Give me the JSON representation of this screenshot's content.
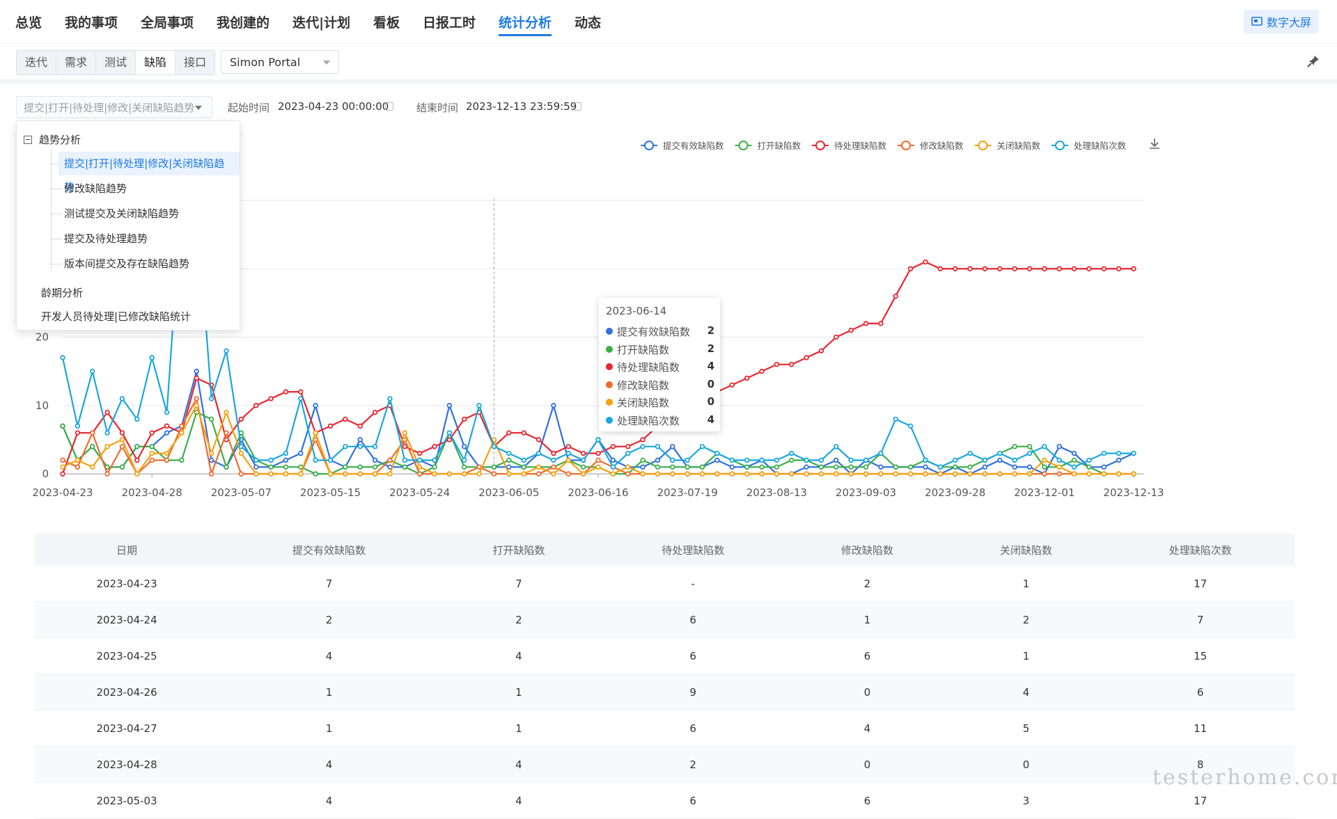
{
  "nav": {
    "items": [
      "总览",
      "我的事项",
      "全局事项",
      "我创建的",
      "迭代|计划",
      "看板",
      "日报工时",
      "统计分析",
      "动态"
    ],
    "active_index": 7,
    "screen_button": "数字大屏"
  },
  "subnav": {
    "segments": [
      "迭代",
      "需求",
      "测试",
      "缺陷",
      "接口"
    ],
    "active_index": 3,
    "project": "Simon Portal"
  },
  "filter": {
    "report": "提交|打开|待处理|修改|关闭缺陷趋势",
    "start_label": "起始时间",
    "start_value": "2023-04-23 00:00:00",
    "end_label": "结束时间",
    "end_value": "2023-12-13 23:59:59"
  },
  "dropdown": {
    "group1": "趋势分析",
    "items": [
      "提交|打开|待处理|修改|关闭缺陷趋势",
      "修改缺陷趋势",
      "测试提交及关闭缺陷趋势",
      "提交及待处理趋势",
      "版本间提交及存在缺陷趋势"
    ],
    "selected_index": 0,
    "group2": "龄期分析",
    "group3": "开发人员待处理|已修改缺陷统计"
  },
  "tooltip": {
    "date": "2023-06-14",
    "rows": [
      {
        "name": "提交有效缺陷数",
        "value": "2",
        "color": "#2f6fe0"
      },
      {
        "name": "打开缺陷数",
        "value": "2",
        "color": "#3cae49"
      },
      {
        "name": "待处理缺陷数",
        "value": "4",
        "color": "#e8262e"
      },
      {
        "name": "修改缺陷数",
        "value": "0",
        "color": "#f06a2e"
      },
      {
        "name": "关闭缺陷数",
        "value": "0",
        "color": "#f5a00f"
      },
      {
        "name": "处理缺陷次数",
        "value": "4",
        "color": "#1aa6de"
      }
    ]
  },
  "chart_data": {
    "type": "line",
    "legend_position": "top-right",
    "ylim": [
      0,
      40
    ],
    "yticks": [
      "0",
      "10",
      "20"
    ],
    "xtick_labels": [
      "2023-04-23",
      "2023-04-28",
      "2023-05-07",
      "2023-05-15",
      "2023-05-24",
      "2023-06-05",
      "2023-06-16",
      "2023-07-19",
      "2023-08-13",
      "2023-09-03",
      "2023-09-28",
      "2023-12-01",
      "2023-12-13"
    ],
    "series": [
      {
        "name": "提交有效缺陷数",
        "color": "#2f6fe0",
        "values": [
          7,
          2,
          4,
          1,
          1,
          4,
          4,
          6,
          7,
          15,
          2,
          1,
          5,
          1,
          1,
          2,
          3,
          10,
          2,
          1,
          5,
          2,
          1,
          1,
          2,
          1,
          10,
          4,
          1,
          1,
          1,
          1,
          3,
          10,
          2,
          2,
          5,
          2,
          1,
          1,
          2,
          4,
          1,
          1,
          2,
          1,
          1,
          2,
          0,
          0,
          1,
          1,
          2,
          0,
          2,
          1,
          1,
          1,
          1,
          0,
          1,
          0,
          1,
          2,
          1,
          1,
          0,
          4,
          3,
          1,
          1,
          2,
          3
        ]
      },
      {
        "name": "打开缺陷数",
        "color": "#3cae49",
        "values": [
          7,
          2,
          4,
          1,
          1,
          4,
          4,
          2,
          2,
          9,
          8,
          1,
          6,
          2,
          1,
          1,
          1,
          0,
          0,
          1,
          1,
          1,
          2,
          1,
          0,
          1,
          6,
          1,
          1,
          1,
          2,
          1,
          1,
          1,
          2,
          1,
          1,
          0,
          0,
          2,
          1,
          1,
          1,
          1,
          3,
          2,
          1,
          1,
          1,
          2,
          2,
          1,
          1,
          1,
          1,
          3,
          1,
          1,
          2,
          1,
          1,
          1,
          2,
          3,
          4,
          4,
          1,
          1,
          2,
          1,
          0,
          0,
          0
        ]
      },
      {
        "name": "待处理缺陷数",
        "color": "#e8262e",
        "values": [
          0,
          6,
          6,
          9,
          6,
          2,
          6,
          7,
          6,
          14,
          13,
          5,
          8,
          10,
          11,
          12,
          12,
          6,
          7,
          8,
          7,
          9,
          10,
          4,
          3,
          4,
          5,
          8,
          9,
          4,
          6,
          6,
          5,
          3,
          4,
          3,
          3,
          4,
          4,
          5,
          7,
          8,
          9,
          11,
          12,
          13,
          14,
          15,
          16,
          16,
          17,
          18,
          20,
          21,
          22,
          22,
          26,
          30,
          31,
          30,
          30,
          30,
          30,
          30,
          30,
          30,
          30,
          30,
          30,
          30,
          30,
          30,
          30
        ]
      },
      {
        "name": "修改缺陷数",
        "color": "#f06a2e",
        "values": [
          2,
          1,
          6,
          0,
          4,
          0,
          2,
          2,
          7,
          11,
          0,
          6,
          0,
          0,
          0,
          0,
          0,
          5,
          0,
          0,
          0,
          0,
          2,
          5,
          0,
          0,
          0,
          0,
          1,
          0,
          0,
          0,
          0,
          1,
          0,
          0,
          2,
          1,
          0,
          0,
          0,
          0,
          0,
          0,
          0,
          0,
          0,
          0,
          0,
          0,
          0,
          0,
          0,
          0,
          0,
          0,
          0,
          0,
          0,
          0,
          0,
          0,
          0,
          0,
          0,
          0,
          0,
          0,
          0,
          0,
          0,
          0,
          0
        ]
      },
      {
        "name": "关闭缺陷数",
        "color": "#f5a00f",
        "values": [
          1,
          2,
          1,
          4,
          5,
          0,
          3,
          3,
          6,
          10,
          3,
          9,
          3,
          0,
          0,
          0,
          0,
          6,
          0,
          0,
          0,
          0,
          0,
          6,
          1,
          0,
          0,
          0,
          0,
          5,
          0,
          0,
          1,
          0,
          2,
          0,
          1,
          0,
          1,
          0,
          0,
          0,
          0,
          0,
          0,
          0,
          0,
          0,
          0,
          0,
          0,
          0,
          0,
          0,
          0,
          0,
          0,
          0,
          0,
          0,
          0,
          0,
          0,
          0,
          0,
          0,
          2,
          1,
          0,
          0,
          0,
          0,
          0
        ]
      },
      {
        "name": "处理缺陷次数",
        "color": "#1aa6de",
        "values": [
          17,
          7,
          15,
          6,
          11,
          8,
          17,
          9,
          40,
          40,
          11,
          18,
          4,
          2,
          2,
          3,
          11,
          2,
          2,
          4,
          4,
          4,
          11,
          2,
          2,
          2,
          6,
          2,
          10,
          4,
          3,
          2,
          3,
          2,
          3,
          2,
          5,
          1,
          3,
          4,
          4,
          2,
          2,
          4,
          3,
          2,
          2,
          2,
          2,
          3,
          2,
          2,
          4,
          2,
          2,
          3,
          8,
          7,
          2,
          1,
          2,
          3,
          2,
          3,
          2,
          3,
          4,
          2,
          1,
          2,
          3,
          3,
          3
        ]
      }
    ]
  },
  "table": {
    "headers": [
      "日期",
      "提交有效缺陷数",
      "打开缺陷数",
      "待处理缺陷数",
      "修改缺陷数",
      "关闭缺陷数",
      "处理缺陷次数"
    ],
    "rows": [
      [
        "2023-04-23",
        "7",
        "7",
        "-",
        "2",
        "1",
        "17"
      ],
      [
        "2023-04-24",
        "2",
        "2",
        "6",
        "1",
        "2",
        "7"
      ],
      [
        "2023-04-25",
        "4",
        "4",
        "6",
        "6",
        "1",
        "15"
      ],
      [
        "2023-04-26",
        "1",
        "1",
        "9",
        "0",
        "4",
        "6"
      ],
      [
        "2023-04-27",
        "1",
        "1",
        "6",
        "4",
        "5",
        "11"
      ],
      [
        "2023-04-28",
        "4",
        "4",
        "2",
        "0",
        "0",
        "8"
      ],
      [
        "2023-05-03",
        "4",
        "4",
        "6",
        "6",
        "3",
        "17"
      ]
    ]
  },
  "watermark": "testerhome.com"
}
